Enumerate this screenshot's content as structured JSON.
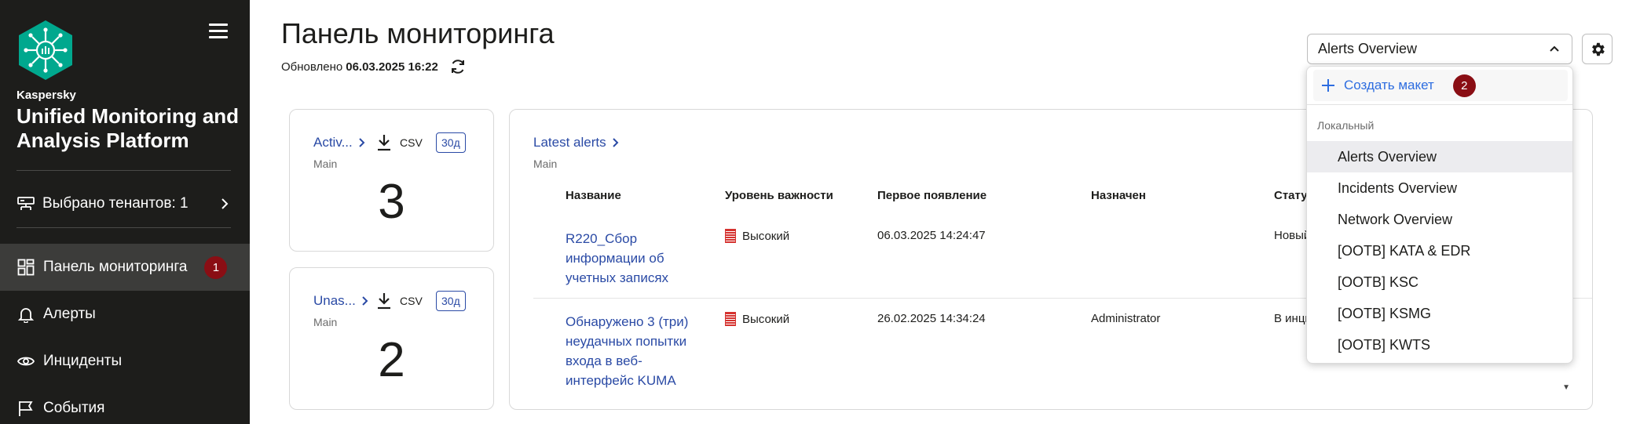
{
  "sidebar": {
    "brand_small": "Kaspersky",
    "brand_big": "Unified Monitoring and Analysis Platform",
    "tenant_label": "Выбрано тенантов: 1",
    "items": [
      {
        "label": "Панель мониторинга",
        "icon": "dashboard-icon",
        "active": true,
        "badge": "1"
      },
      {
        "label": "Алерты",
        "icon": "bell-icon"
      },
      {
        "label": "Инциденты",
        "icon": "eye-icon"
      },
      {
        "label": "События",
        "icon": "flag-icon"
      }
    ]
  },
  "header": {
    "title": "Панель мониторинга",
    "updated_label": "Обновлено",
    "updated_value": "06.03.2025 16:22",
    "layout_selected": "Alerts Overview"
  },
  "widgets": {
    "active": {
      "title": "Activ...",
      "subtitle": "Main",
      "csv": "CSV",
      "period": "30д",
      "value": "3"
    },
    "unassigned": {
      "title": "Unas...",
      "subtitle": "Main",
      "csv": "CSV",
      "period": "30д",
      "value": "2"
    },
    "latest_alerts": {
      "title": "Latest alerts",
      "subtitle": "Main",
      "columns": [
        "Название",
        "Уровень важности",
        "Первое появление",
        "Назначен",
        "Статус"
      ],
      "rows": [
        {
          "name": "R220_Сбор информации об учетных записях",
          "severity": "Высокий",
          "first_seen": "06.03.2025 14:24:47",
          "assigned": "",
          "status": "Новый"
        },
        {
          "name": "Обнаружено 3 (три) неудачных попытки входа в веб-интерфейс KUMA",
          "severity": "Высокий",
          "first_seen": "26.02.2025 14:34:24",
          "assigned": "Administrator",
          "status": "В инци"
        }
      ]
    }
  },
  "dropdown": {
    "create_label": "Создать макет",
    "create_badge": "2",
    "group_label": "Локальный",
    "items": [
      "Alerts Overview",
      "Incidents Overview",
      "Network Overview",
      "[OOTB] KATA & EDR",
      "[OOTB] KSC",
      "[OOTB] KSMG",
      "[OOTB] KWTS"
    ],
    "selected": "Alerts Overview"
  },
  "colors": {
    "sidebar_bg": "#1d1d1b",
    "accent_teal": "#00a88e",
    "link_blue": "#2a4aa5",
    "badge_red": "#8a0e14",
    "severity_red": "#d5322f"
  }
}
